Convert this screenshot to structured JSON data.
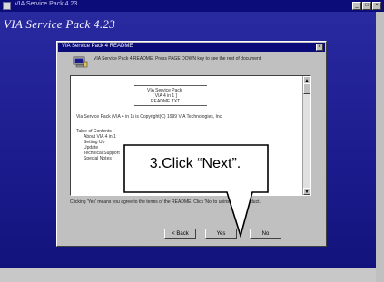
{
  "outer_window": {
    "title": "VIA Service Pack 4.23",
    "controls": [
      "_",
      "□",
      "×"
    ],
    "stage_title": "VIA Service Pack 4.23"
  },
  "dialog": {
    "title": "VIA Service Pack 4 README",
    "close": "×",
    "hint": "VIA Service Pack 4 README. Press PAGE DOWN key to see the rest of document.",
    "readme_lines": [
      "VIA Service Pack",
      "[ VIA 4 in 1 ]",
      "README.TXT",
      "Via Service Pack (VIA 4 in 1) is Copyright(C) 1999 VIA Technologies, Inc.",
      "Table of Contents",
      "About VIA 4 in 1",
      "Setting Up",
      "Update",
      "Technical Support",
      "Special Notes"
    ],
    "footer": "Clicking 'Yes' means you agree to the terms of the README. Click 'No' to uninstall the product.",
    "buttons": {
      "back": "< Back",
      "next": "Yes",
      "cancel": "No"
    }
  },
  "callout": {
    "text": "3.Click “Next”."
  }
}
